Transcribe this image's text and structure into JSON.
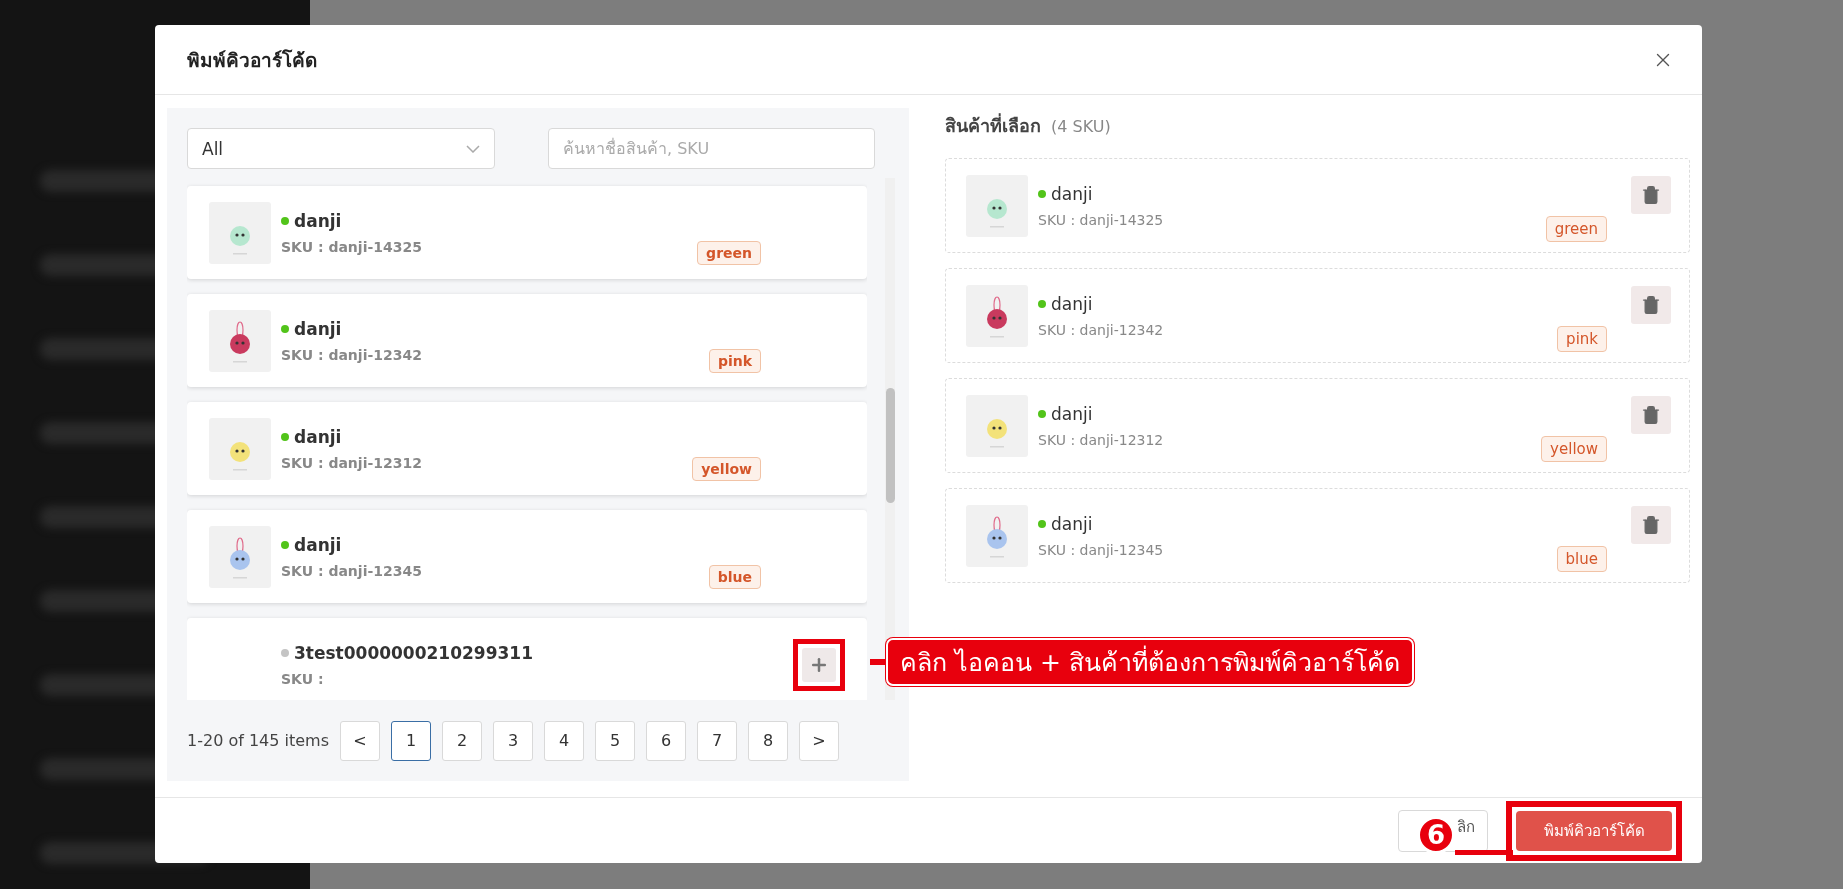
{
  "dialog": {
    "title": "พิมพ์คิวอาร์โค้ด"
  },
  "filter": {
    "category": "All",
    "search_placeholder": "ค้นหาชื่อสินค้า, SKU"
  },
  "products": [
    {
      "name": "danji",
      "sku": "SKU : danji-14325",
      "variant": "green",
      "active": true,
      "selected": true
    },
    {
      "name": "danji",
      "sku": "SKU : danji-12342",
      "variant": "pink",
      "active": true,
      "selected": true
    },
    {
      "name": "danji",
      "sku": "SKU : danji-12312",
      "variant": "yellow",
      "active": true,
      "selected": true
    },
    {
      "name": "danji",
      "sku": "SKU : danji-12345",
      "variant": "blue",
      "active": true,
      "selected": true
    },
    {
      "name": "3test0000000210299311",
      "sku": "SKU :",
      "active": false,
      "selected": false
    }
  ],
  "pagination": {
    "summary": "1-20 of 145 items",
    "prev": "<",
    "next": ">",
    "pages": [
      {
        "label": "1",
        "selected": true
      },
      {
        "label": "2",
        "selected": false
      },
      {
        "label": "3",
        "selected": false
      },
      {
        "label": "4",
        "selected": false
      },
      {
        "label": "5",
        "selected": false
      },
      {
        "label": "6",
        "selected": false
      },
      {
        "label": "7",
        "selected": false
      },
      {
        "label": "8",
        "selected": false
      }
    ]
  },
  "selected_panel": {
    "title": "สินค้าที่เลือก",
    "count": "(4 SKU)",
    "items": [
      {
        "name": "danji",
        "sku": "SKU : danji-14325",
        "variant": "green",
        "active": true
      },
      {
        "name": "danji",
        "sku": "SKU : danji-12342",
        "variant": "pink",
        "active": true
      },
      {
        "name": "danji",
        "sku": "SKU : danji-12312",
        "variant": "yellow",
        "active": true
      },
      {
        "name": "danji",
        "sku": "SKU : danji-12345",
        "variant": "blue",
        "active": true
      }
    ]
  },
  "footer": {
    "cancel": "ลิก",
    "print": "พิมพ์คิวอาร์โค้ด"
  },
  "annotations": {
    "callout": "คลิก ไอคอน + สินค้าที่ต้องการพิมพ์คิวอาร์โค้ด",
    "step": "6"
  }
}
